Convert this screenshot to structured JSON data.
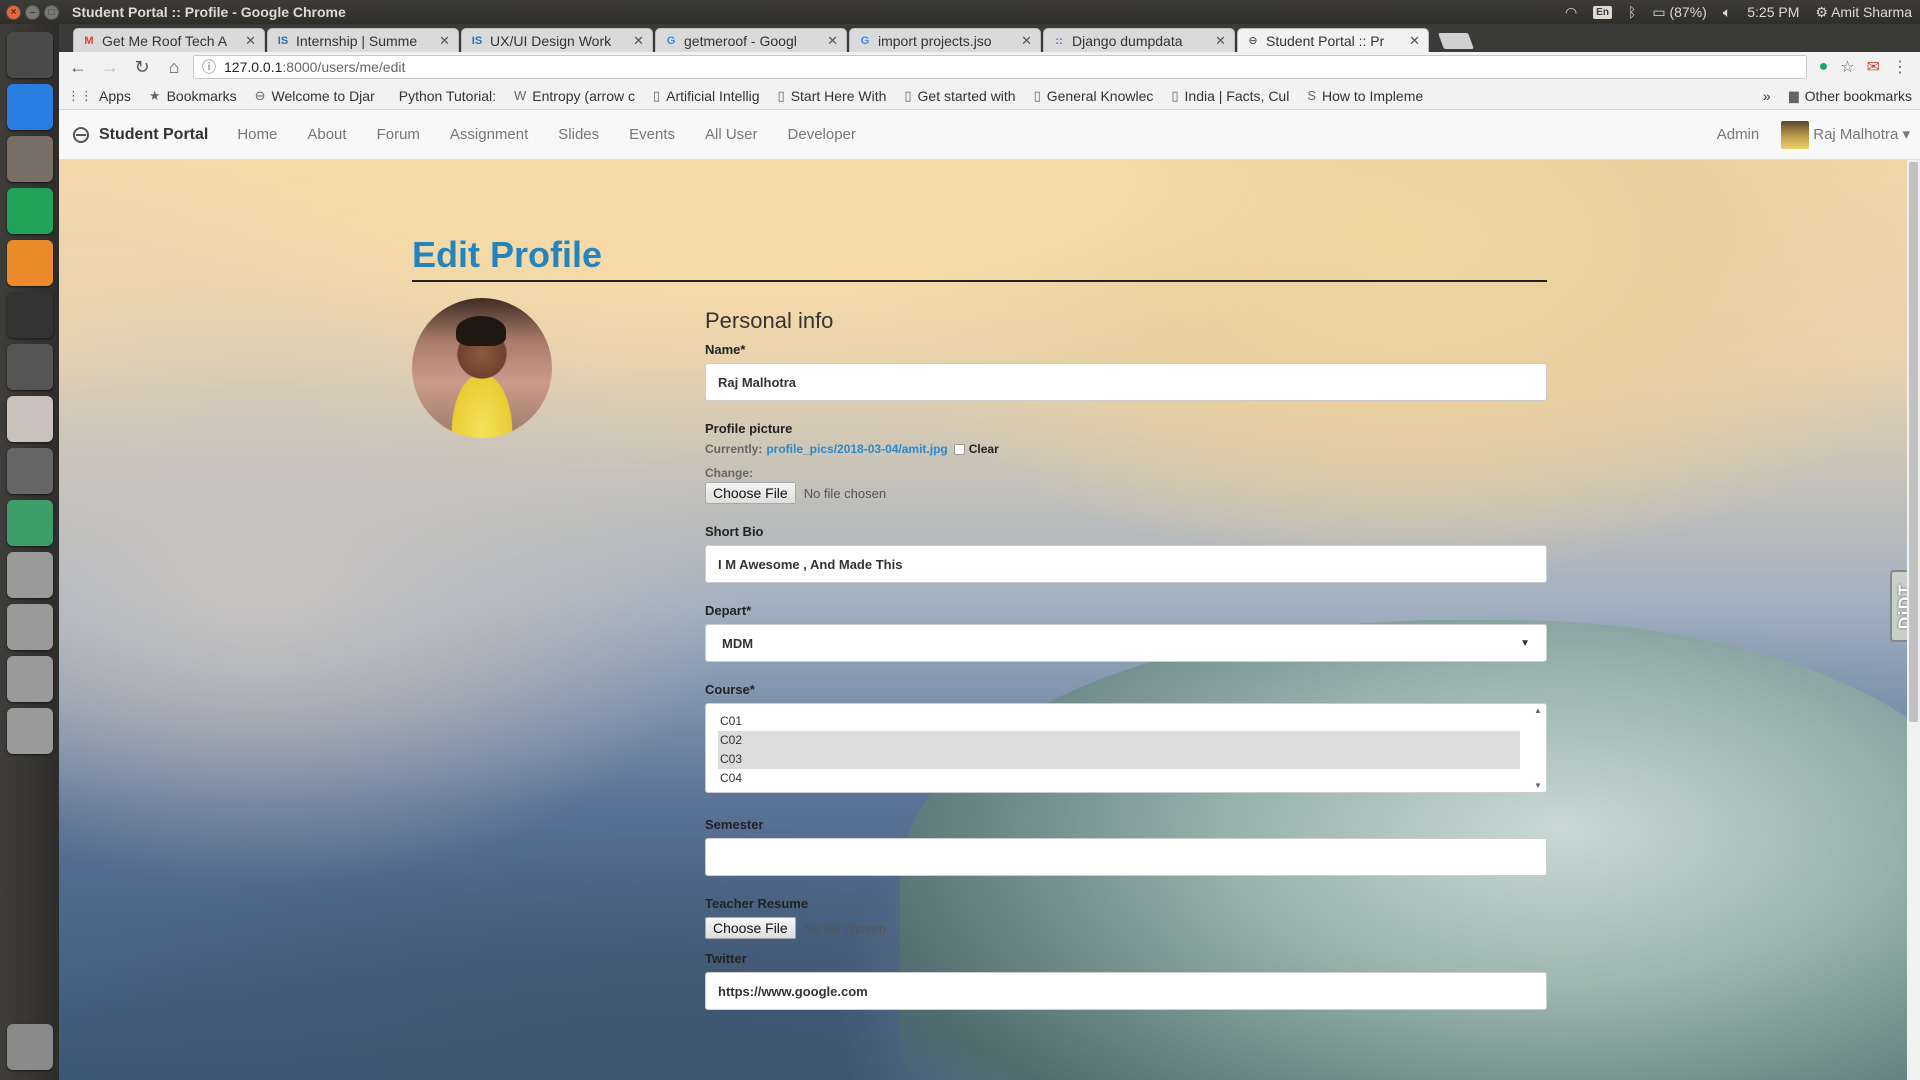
{
  "os": {
    "window_title": "Student Portal :: Profile - Google Chrome",
    "lang": "En",
    "battery": "(87%)",
    "time": "5:25 PM",
    "user": "Amit Sharma"
  },
  "launcher": [
    {
      "name": "ubuntu-dash-icon",
      "color": "#4a4a4a"
    },
    {
      "name": "chrome-icon",
      "color": "#2a7de1"
    },
    {
      "name": "files-icon",
      "color": "#7a6f66"
    },
    {
      "name": "pycharm-icon",
      "color": "#21a45a"
    },
    {
      "name": "sublime-icon",
      "color": "#ea8a2a"
    },
    {
      "name": "terminal-icon",
      "color": "#333333"
    },
    {
      "name": "workspace-switcher-icon",
      "color": "#555555"
    },
    {
      "name": "text-editor-icon",
      "color": "#c9c2bc"
    },
    {
      "name": "settings-icon",
      "color": "#666666"
    },
    {
      "name": "atom-icon",
      "color": "#3d9e6a"
    },
    {
      "name": "drive-icon",
      "color": "#9a9a9a"
    },
    {
      "name": "drive-icon",
      "color": "#9a9a9a"
    },
    {
      "name": "drive-icon",
      "color": "#9a9a9a"
    },
    {
      "name": "drive-icon",
      "color": "#9a9a9a"
    }
  ],
  "tabs": [
    {
      "label": "Get Me Roof Tech A",
      "fav": "M",
      "favcolor": "#d44638"
    },
    {
      "label": "Internship | Summe",
      "fav": "IS",
      "favcolor": "#2a6fb5"
    },
    {
      "label": "UX/UI Design Work",
      "fav": "IS",
      "favcolor": "#2a6fb5"
    },
    {
      "label": "getmeroof - Googl",
      "fav": "G",
      "favcolor": "#4285f4"
    },
    {
      "label": "import projects.jso",
      "fav": "G",
      "favcolor": "#4285f4"
    },
    {
      "label": "Django dumpdata",
      "fav": "::",
      "favcolor": "#3a76c4"
    },
    {
      "label": "Student Portal :: Pr",
      "fav": "⊖",
      "favcolor": "#555555",
      "active": true
    }
  ],
  "toolbar": {
    "url_host": "127.0.0.1",
    "url_rest": ":8000/users/me/edit"
  },
  "bookmarks": [
    {
      "label": "Apps",
      "icon": "⋮⋮"
    },
    {
      "label": "Bookmarks",
      "icon": "★"
    },
    {
      "label": "Welcome to Djar",
      "icon": "⊖"
    },
    {
      "label": "Python Tutorial:",
      "icon": " "
    },
    {
      "label": "Entropy (arrow c",
      "icon": "W"
    },
    {
      "label": "Artificial Intellig",
      "icon": "▯"
    },
    {
      "label": "Start Here With",
      "icon": "▯"
    },
    {
      "label": "Get started with",
      "icon": "▯"
    },
    {
      "label": "General Knowlec",
      "icon": "▯"
    },
    {
      "label": "India | Facts, Cul",
      "icon": "▯"
    },
    {
      "label": "How to Impleme",
      "icon": "S"
    }
  ],
  "bookmarks_more": "»",
  "other_bookmarks": "Other bookmarks",
  "nav": {
    "brand": "Student Portal",
    "links": [
      "Home",
      "About",
      "Forum",
      "Assignment",
      "Slides",
      "Events",
      "All User",
      "Developer"
    ],
    "admin": "Admin",
    "user": "Raj Malhotra"
  },
  "page": {
    "title": "Edit Profile",
    "section": "Personal info",
    "name_label": "Name*",
    "name_value": "Raj Malhotra",
    "pic_label": "Profile picture",
    "currently": "Currently:",
    "pic_link": "profile_pics/2018-03-04/amit.jpg",
    "clear": "Clear",
    "change": "Change:",
    "choose_file": "Choose File",
    "no_file": "No file chosen",
    "bio_label": "Short Bio",
    "bio_value": "I M Awesome , And Made This",
    "depart_label": "Depart*",
    "depart_value": "MDM",
    "course_label": "Course*",
    "courses": [
      {
        "label": "C01",
        "selected": false
      },
      {
        "label": "C02",
        "selected": true
      },
      {
        "label": "C03",
        "selected": true
      },
      {
        "label": "C04",
        "selected": false
      }
    ],
    "semester_label": "Semester",
    "semester_value": "",
    "resume_label": "Teacher Resume",
    "twitter_label": "Twitter",
    "twitter_value": "https://www.google.com"
  },
  "devtab": "DjDT"
}
